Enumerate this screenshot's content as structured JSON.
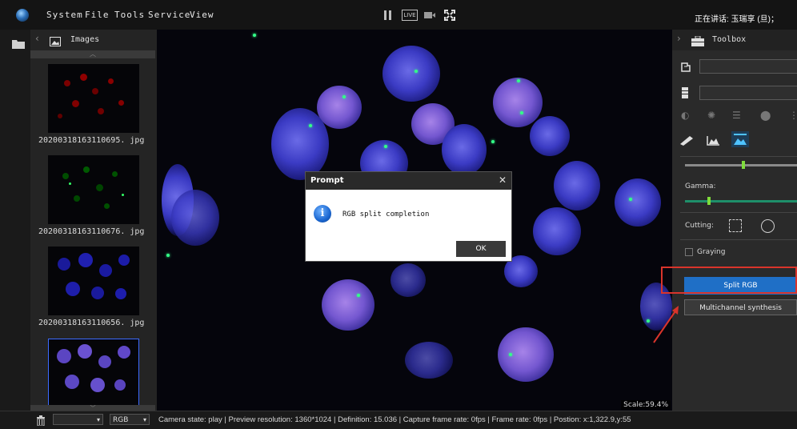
{
  "menu": {
    "items": [
      "System",
      "File",
      "Tools",
      "Service",
      "View"
    ]
  },
  "toolbar": {
    "live_label": "LIVE"
  },
  "notice": {
    "speaking": "正在讲话: 玉瑞享 (旦)；"
  },
  "images_panel": {
    "title": "Images",
    "thumbnails": [
      {
        "label": "20200318163110695. jpg",
        "channel": "red"
      },
      {
        "label": "20200318163110676. jpg",
        "channel": "green"
      },
      {
        "label": "20200318163110656. jpg",
        "channel": "blue"
      },
      {
        "label": "",
        "channel": "merged"
      }
    ]
  },
  "viewer": {
    "scale": "Scale:59.4%"
  },
  "dialog": {
    "title": "Prompt",
    "message": "RGB split completion",
    "ok_label": "OK"
  },
  "toolbox": {
    "title": "Toolbox",
    "gamma_label": "Gamma:",
    "cutting_label": "Cutting:",
    "graying_label": "Graying",
    "split_rgb_label": "Split RGB",
    "multichannel_label": "Multichannel synthesis"
  },
  "statusbar": {
    "channel_select": "RGB",
    "text": "Camera state:  play | Preview resolution:  1360*1024 | Definition:  15.036 | Capture frame rate:  0fps | Frame rate:  0fps | Postion:   x:1,322.9,y:55"
  },
  "colors": {
    "accent": "#1f6fc6",
    "highlight": "#d9342b"
  }
}
